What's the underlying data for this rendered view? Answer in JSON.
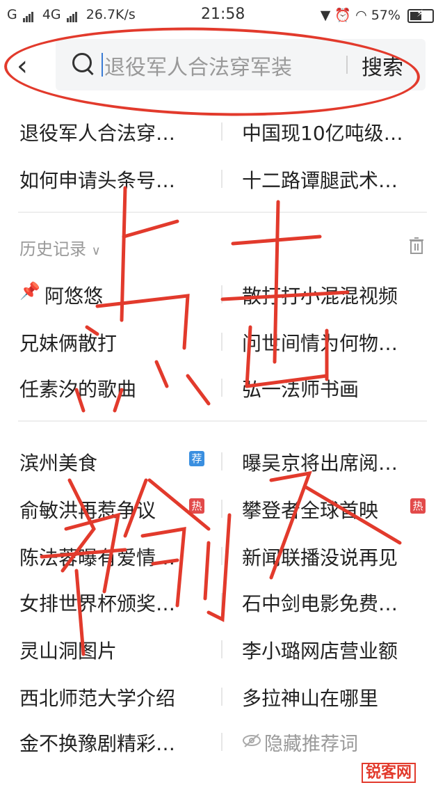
{
  "status_bar": {
    "left": "G",
    "network": "4G",
    "speed": "26.7K/s",
    "time": "21:58",
    "battery": "57%",
    "battery_level": 0.57
  },
  "search": {
    "query": "退役军人合法穿军装",
    "button": "搜索"
  },
  "suggestions": [
    [
      "退役军人合法穿…",
      "中国现10亿吨级…"
    ],
    [
      "如何申请头条号…",
      "十二路谭腿武术…"
    ]
  ],
  "history": {
    "title": "历史记录",
    "items": [
      [
        "阿悠悠",
        "散打打小混混视频"
      ],
      [
        "兄妹俩散打",
        "问世间情为何物…"
      ],
      [
        "任素汐的歌曲",
        "弘一法师书画"
      ]
    ]
  },
  "trending": {
    "items": [
      {
        "left": "滨州美食",
        "left_badge": "荐",
        "right": "曝吴京将出席阅…",
        "right_badge": ""
      },
      {
        "left": "俞敏洪再惹争议",
        "left_badge": "热",
        "right": "攀登者全球首映",
        "right_badge": "热"
      },
      {
        "left": "陈法蓉曝有爱情…",
        "left_badge": "",
        "right": "新闻联播没说再见",
        "right_badge": ""
      },
      {
        "left": "女排世界杯颁奖…",
        "left_badge": "",
        "right": "石中剑电影免费…",
        "right_badge": ""
      },
      {
        "left": "灵山洞图片",
        "left_badge": "",
        "right": "李小璐网店营业额",
        "right_badge": ""
      },
      {
        "left": "西北师范大学介绍",
        "left_badge": "",
        "right": "多拉神山在哪里",
        "right_badge": ""
      },
      {
        "left": "金不换豫剧精彩…",
        "left_badge": "",
        "right": "",
        "right_badge": ""
      }
    ],
    "hide_label": "隐藏推荐词"
  },
  "watermark": "锐客网",
  "colors": {
    "annotation": "#e23a2c",
    "badge_rec": "#3a8fe0",
    "badge_hot": "#e24a4a"
  }
}
